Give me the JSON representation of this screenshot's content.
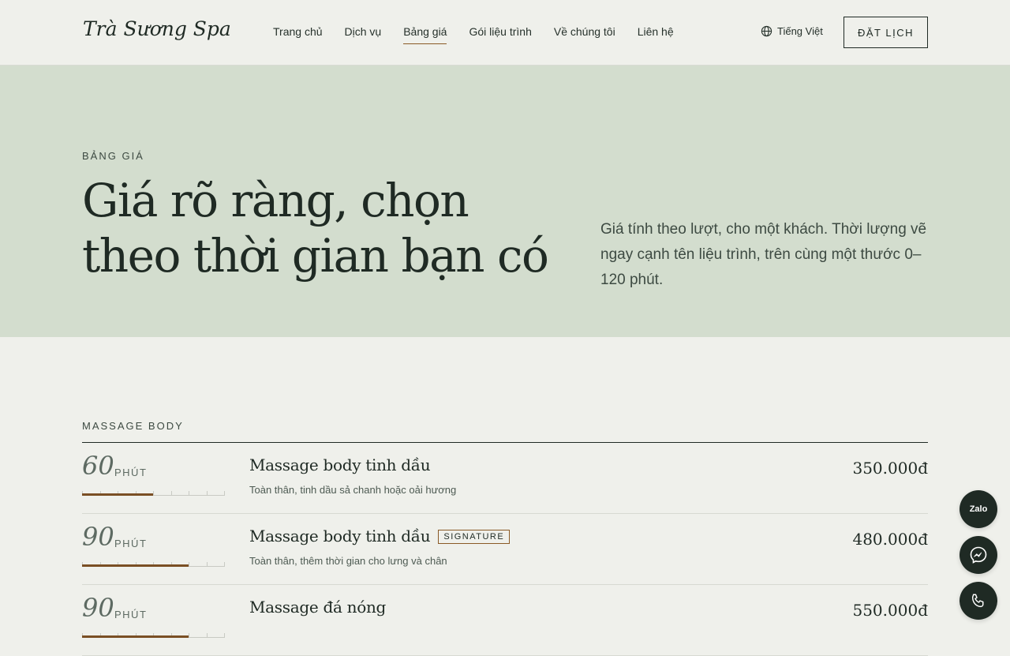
{
  "brand": {
    "logo": "Trà Sương Spa"
  },
  "nav": {
    "items": [
      {
        "label": "Trang chủ"
      },
      {
        "label": "Dịch vụ"
      },
      {
        "label": "Bảng giá",
        "active": true
      },
      {
        "label": "Gói liệu trình"
      },
      {
        "label": "Về chúng tôi"
      },
      {
        "label": "Liên hệ"
      }
    ],
    "language": "Tiếng Việt",
    "book_label": "ĐẶT LỊCH"
  },
  "hero": {
    "eyebrow": "BẢNG GIÁ",
    "title_line1": "Giá rõ ràng, chọn",
    "title_line2": "theo thời gian bạn có",
    "text": "Giá tính theo lượt, cho một khách. Thời lượng vẽ ngay cạnh tên liệu trình, trên cùng một thước 0–120 phút."
  },
  "section": {
    "label": "MASSAGE BODY",
    "scale_max_minutes": 120,
    "rows": [
      {
        "minutes": "60",
        "unit": "PHÚT",
        "name": "Massage body tinh dầu",
        "badge": "",
        "description": "Toàn thân, tinh dầu sả chanh hoặc oải hương",
        "price": "350.000đ"
      },
      {
        "minutes": "90",
        "unit": "PHÚT",
        "name": "Massage body tinh dầu",
        "badge": "SIGNATURE",
        "description": "Toàn thân, thêm thời gian cho lưng và chân",
        "price": "480.000đ"
      },
      {
        "minutes": "90",
        "unit": "PHÚT",
        "name": "Massage đá nóng",
        "badge": "",
        "description": "",
        "price": "550.000đ"
      }
    ]
  },
  "floating": {
    "zalo_label": "Zalo"
  },
  "colors": {
    "accent": "#7a4f24",
    "hero_bg": "#d3ddce",
    "page_bg": "#eff0eb",
    "dark": "#1f2a24"
  }
}
